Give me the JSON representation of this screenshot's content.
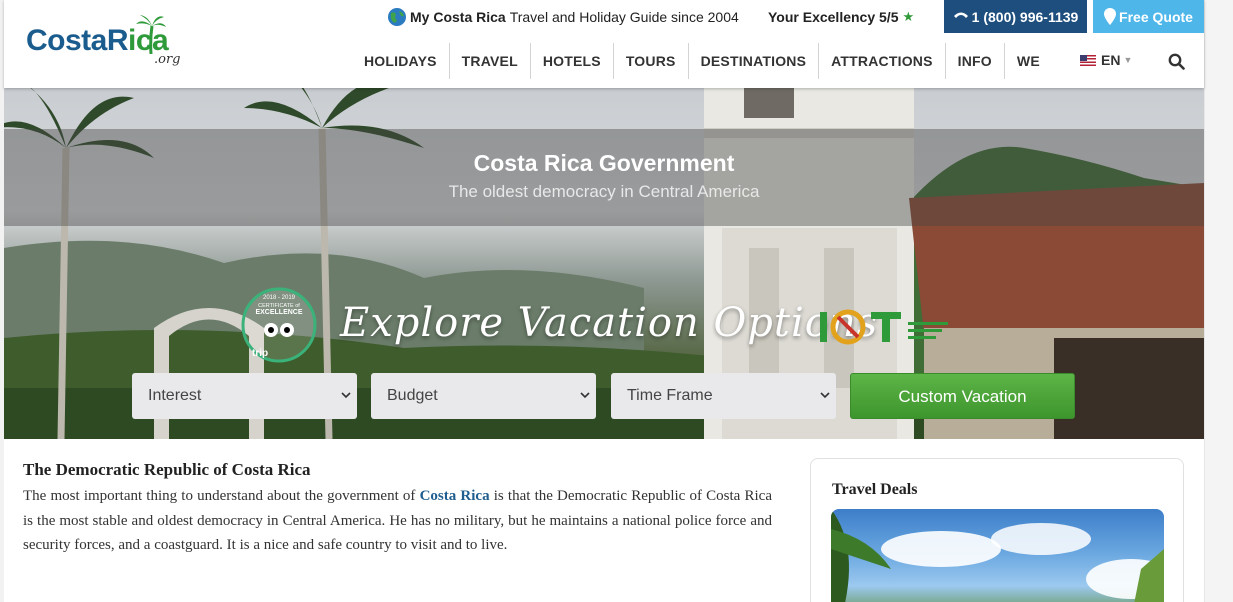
{
  "header": {
    "logo": {
      "main": "CostaRica",
      "main_part1": "CostaR",
      "main_part2": "ica",
      "suffix": ".org"
    },
    "tagline": {
      "bold": "My Costa Rica",
      "rest": "Travel and Holiday Guide since 2004"
    },
    "excellency": {
      "label": "Your Excellency 5/5",
      "star": "★"
    },
    "phone": {
      "label": "1 (800) 996-1139",
      "icon": "phone-icon"
    },
    "quote": {
      "label": "Free Quote",
      "icon": "map-pin-icon"
    },
    "nav": {
      "items": [
        {
          "label": "HOLIDAYS"
        },
        {
          "label": "TRAVEL"
        },
        {
          "label": "HOTELS"
        },
        {
          "label": "TOURS"
        },
        {
          "label": "DESTINATIONS"
        },
        {
          "label": "ATTRACTIONS"
        },
        {
          "label": "INFO"
        },
        {
          "label": "WE"
        }
      ]
    },
    "language": {
      "label": "EN",
      "caret": "▼"
    }
  },
  "hero": {
    "title": "Costa Rica Government",
    "subtitle": "The oldest democracy in Central America",
    "explore_heading": "Explore Vacation Options",
    "badge": {
      "years": "2018 - 2019",
      "line1": "CERTIFICATE of",
      "line2": "EXCELLENCE",
      "brand": "trip"
    },
    "selects": {
      "interest": "Interest",
      "budget": "Budget",
      "timeframe": "Time Frame"
    },
    "cta_label": "Custom Vacation"
  },
  "article": {
    "title": "The Democratic Republic of Costa Rica",
    "body_before_link": "The most important thing to understand about the government of ",
    "link_text": "Costa Rica",
    "body_after_link": " is that the Democratic Republic of Costa Rica is the most stable and oldest democracy in Central America. He has no military, but he maintains a national police force and security forces, and a coastguard. It is a nice and safe country to visit and to live."
  },
  "sidebar": {
    "deals_title": "Travel Deals"
  },
  "colors": {
    "brand_blue": "#1a5c8e",
    "brand_green": "#2e9a3a",
    "phone_bg": "#1d4e7e",
    "quote_bg": "#4fb6ea",
    "cta_green": "#4aa83a"
  }
}
